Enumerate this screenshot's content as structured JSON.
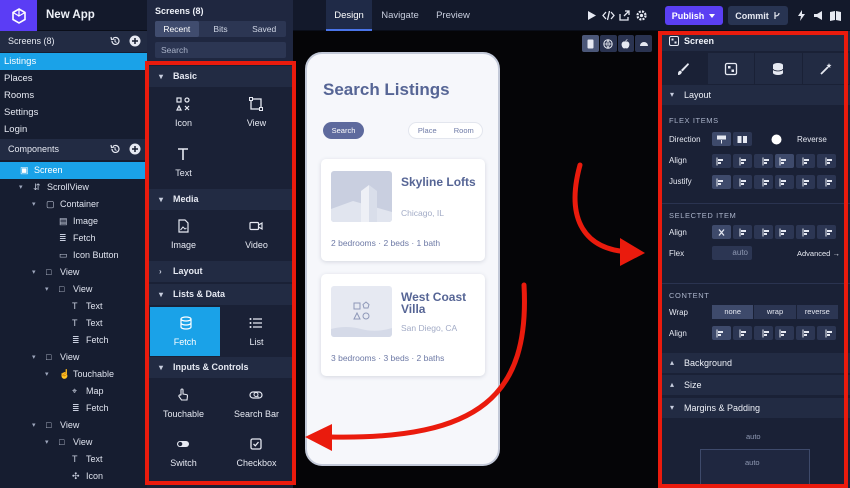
{
  "app": {
    "title": "New App"
  },
  "top_tabs": [
    "Design",
    "Navigate",
    "Preview"
  ],
  "top_actions": {
    "publish": "Publish",
    "commit": "Commit"
  },
  "screens_panel": {
    "title": "Screens (8)",
    "items": [
      "Listings",
      "Places",
      "Rooms",
      "Settings",
      "Login"
    ]
  },
  "components_panel": {
    "title": "Components",
    "tree": [
      {
        "label": "Screen",
        "icon": "screen-icon"
      },
      {
        "label": "ScrollView",
        "icon": "scrollview-icon"
      },
      {
        "label": "Container",
        "icon": "container-icon"
      },
      {
        "label": "Image",
        "icon": "image-icon"
      },
      {
        "label": "Fetch",
        "icon": "database-icon"
      },
      {
        "label": "Icon Button",
        "icon": "icon-button-icon"
      },
      {
        "label": "View",
        "icon": "view-icon"
      },
      {
        "label": "View",
        "icon": "view-icon"
      },
      {
        "label": "Text",
        "icon": "text-icon"
      },
      {
        "label": "Text",
        "icon": "text-icon"
      },
      {
        "label": "Fetch",
        "icon": "database-icon"
      },
      {
        "label": "View",
        "icon": "view-icon"
      },
      {
        "label": "Touchable",
        "icon": "touch-icon"
      },
      {
        "label": "Map",
        "icon": "map-pin-icon"
      },
      {
        "label": "Fetch",
        "icon": "database-icon"
      },
      {
        "label": "View",
        "icon": "view-icon"
      },
      {
        "label": "View",
        "icon": "view-icon"
      },
      {
        "label": "Text",
        "icon": "text-icon"
      },
      {
        "label": "Icon",
        "icon": "icon-grid-icon"
      }
    ]
  },
  "palette_popover": {
    "title": "Screens (8)",
    "tabs": [
      "Recent",
      "Bits",
      "Saved"
    ],
    "search_placeholder": "Search"
  },
  "palette": {
    "sections": {
      "basic": "Basic",
      "media": "Media",
      "layout": "Layout",
      "lists": "Lists & Data",
      "inputs": "Inputs & Controls"
    },
    "items": {
      "icon": "Icon",
      "view": "View",
      "text": "Text",
      "image": "Image",
      "video": "Video",
      "fetch": "Fetch",
      "list": "List",
      "touchable": "Touchable",
      "search_bar": "Search Bar",
      "switch": "Switch",
      "checkbox": "Checkbox"
    }
  },
  "preview": {
    "title": "Search Listings",
    "search_button": "Search",
    "toggle": [
      "Place",
      "Room"
    ],
    "cards": [
      {
        "title": "Skyline Lofts",
        "location": "Chicago, IL",
        "meta": "2 bedrooms · 2 beds · 1 bath"
      },
      {
        "title": "West Coast Villa",
        "location": "San Diego, CA",
        "meta": "3 bedrooms · 3 beds · 2 baths"
      }
    ]
  },
  "properties": {
    "header": "Screen",
    "layout": "Layout",
    "flex_items": "FLEX ITEMS",
    "direction": "Direction",
    "reverse": "Reverse",
    "align": "Align",
    "justify": "Justify",
    "selected_item": "SELECTED ITEM",
    "flex": "Flex",
    "flex_value": "auto",
    "advanced": "Advanced →",
    "content": "CONTENT",
    "wrap": "Wrap",
    "wrap_options": [
      "none",
      "wrap",
      "reverse"
    ],
    "sections": [
      "Background",
      "Size",
      "Margins & Padding"
    ],
    "box_auto": "auto",
    "accent_color": "#ea1b0d"
  }
}
